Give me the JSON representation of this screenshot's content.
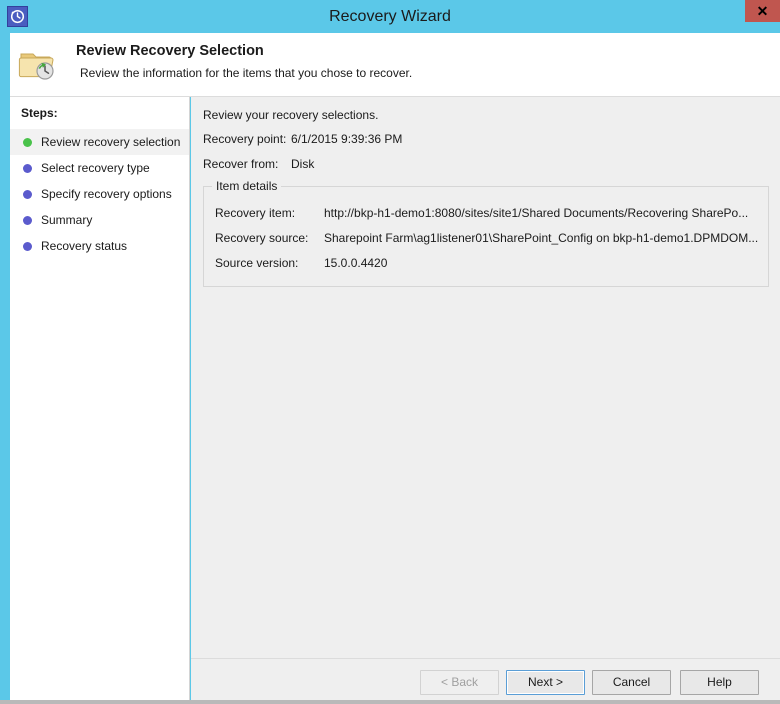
{
  "window": {
    "title": "Recovery Wizard",
    "app_icon": "restore-clock-icon",
    "close_label": "✕",
    "titlebar_color": "#5bc8e8",
    "close_button_color": "#c0564f"
  },
  "header": {
    "icon": "folder-recovery-icon",
    "title": "Review Recovery Selection",
    "subtitle": "Review the information for the items that you chose to recover."
  },
  "sidebar": {
    "heading": "Steps:",
    "items": [
      {
        "label": "Review recovery selection",
        "bullet": "#49c24a",
        "active": true
      },
      {
        "label": "Select recovery type",
        "bullet": "#5b5bcd",
        "active": false
      },
      {
        "label": "Specify recovery options",
        "bullet": "#5b5bcd",
        "active": false
      },
      {
        "label": "Summary",
        "bullet": "#5b5bcd",
        "active": false
      },
      {
        "label": "Recovery status",
        "bullet": "#5b5bcd",
        "active": false
      }
    ]
  },
  "main": {
    "intro": "Review your recovery selections.",
    "summary": [
      {
        "label": "Recovery point:",
        "value": "6/1/2015 9:39:36 PM"
      },
      {
        "label": "Recover from:",
        "value": "Disk"
      }
    ],
    "group": {
      "legend": "Item details",
      "rows": [
        {
          "label": "Recovery item:",
          "value": "http://bkp-h1-demo1:8080/sites/site1/Shared Documents/Recovering SharePo..."
        },
        {
          "label": "Recovery source:",
          "value": "Sharepoint Farm\\ag1listener01\\SharePoint_Config on bkp-h1-demo1.DPMDOM..."
        },
        {
          "label": "Source version:",
          "value": "15.0.0.4420"
        }
      ]
    }
  },
  "footer": {
    "buttons": [
      {
        "label": "< Back",
        "state": "disabled"
      },
      {
        "label": "Next >",
        "state": "default"
      },
      {
        "label": "Cancel",
        "state": "normal"
      },
      {
        "label": "Help",
        "state": "normal"
      }
    ]
  }
}
